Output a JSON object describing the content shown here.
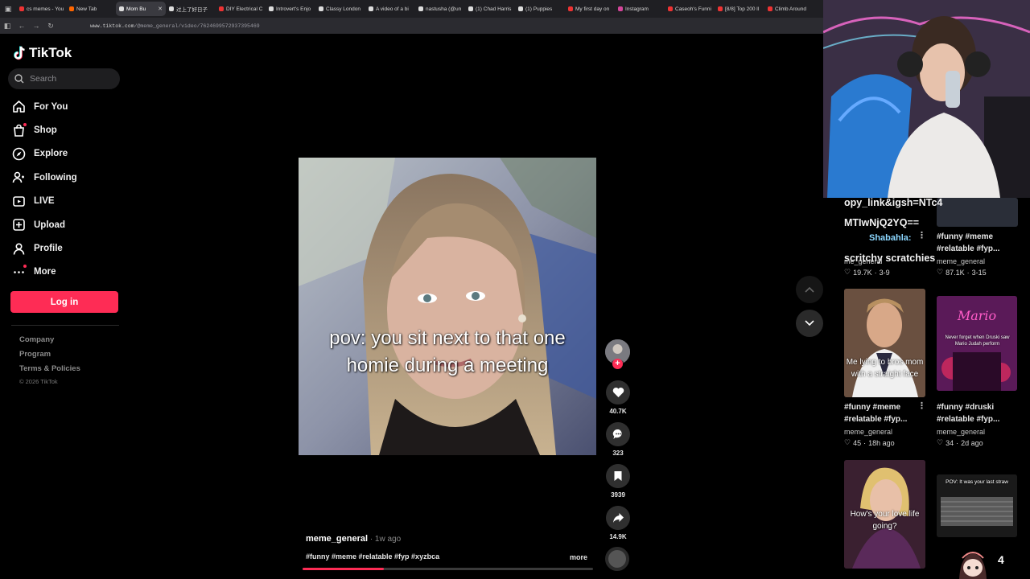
{
  "browser": {
    "tabs": [
      {
        "label": "cs memes - You",
        "color": "#e33"
      },
      {
        "label": "New Tab",
        "color": "#f60"
      },
      {
        "label": "Mom Bu",
        "color": "#ddd",
        "active": true
      },
      {
        "label": "过上了好日子",
        "color": "#ddd"
      },
      {
        "label": "DIY Electrical C",
        "color": "#e33"
      },
      {
        "label": "Introvert's Enjo",
        "color": "#ddd"
      },
      {
        "label": "Classy London",
        "color": "#ddd"
      },
      {
        "label": "A video of a bi",
        "color": "#ddd"
      },
      {
        "label": "nastusha (@un",
        "color": "#ddd"
      },
      {
        "label": "(1) Chad Harris",
        "color": "#ddd"
      },
      {
        "label": "(1) Puppies",
        "color": "#ddd"
      },
      {
        "label": "My first day on",
        "color": "#e33"
      },
      {
        "label": "Instagram",
        "color": "#d4459a"
      },
      {
        "label": "Caseoh's Funni",
        "color": "#e33"
      },
      {
        "label": "[8/8] Top 200 ll",
        "color": "#e33"
      },
      {
        "label": "Climb Around",
        "color": "#e33"
      }
    ],
    "url_host": "www.tiktok.com",
    "url_path": "/@meme_general/video/7624699572937395469"
  },
  "sidebar": {
    "logo": "TikTok",
    "search_placeholder": "Search",
    "items": [
      {
        "label": "For You",
        "icon": "home-icon"
      },
      {
        "label": "Shop",
        "icon": "shop-icon"
      },
      {
        "label": "Explore",
        "icon": "compass-icon"
      },
      {
        "label": "Following",
        "icon": "following-icon"
      },
      {
        "label": "LIVE",
        "icon": "live-icon"
      },
      {
        "label": "Upload",
        "icon": "upload-icon"
      },
      {
        "label": "Profile",
        "icon": "profile-icon"
      },
      {
        "label": "More",
        "icon": "more-icon"
      }
    ],
    "login": "Log in",
    "footer": [
      "Company",
      "Program",
      "Terms & Policies"
    ],
    "copyright": "© 2026 TikTok"
  },
  "video": {
    "caption_line1": "pov: you sit next to that one",
    "caption_line2": "homie during a meeting",
    "author": "meme_general",
    "ago": " · 1w ago",
    "tags": "#funny #meme #relatable #fyp #xyzbca",
    "more": "more",
    "progress": 0.28,
    "likes": "40.7K",
    "comments": "323",
    "saves": "3939",
    "shares": "14.9K",
    "follow": "+"
  },
  "right": {
    "overlay_lines": [
      "opy_link&igsh=NTc4",
      "MTIwNjQ2YQ==",
      "Shabahla:",
      "scritchy scratchies"
    ],
    "cards": [
      {
        "title1": "#funny #meme",
        "title2": "#relatable #fyp...",
        "author": "me_general",
        "likes": "19.7K",
        "date": "3-9"
      },
      {
        "title1": "#funny #meme",
        "title2": "#relatable #fyp...",
        "author": "meme_general",
        "likes": "87.1K",
        "date": "3-15"
      },
      {
        "title1": "#funny #meme",
        "title2": "#relatable #fyp...",
        "author": "meme_general",
        "likes": "45",
        "date": "18h ago",
        "thumb_text": "Me lying to bros mom with a straight face"
      },
      {
        "title1": "#funny #druski",
        "title2": "#relatable #fyp...",
        "author": "meme_general",
        "likes": "34",
        "date": "2d ago",
        "thumb_text": "Never forget when Druski saw Mario Judah perform"
      },
      {
        "thumb_text": "How's your love life going?"
      },
      {
        "thumb_text": "POV: It was your last straw"
      }
    ],
    "counter": "4"
  }
}
